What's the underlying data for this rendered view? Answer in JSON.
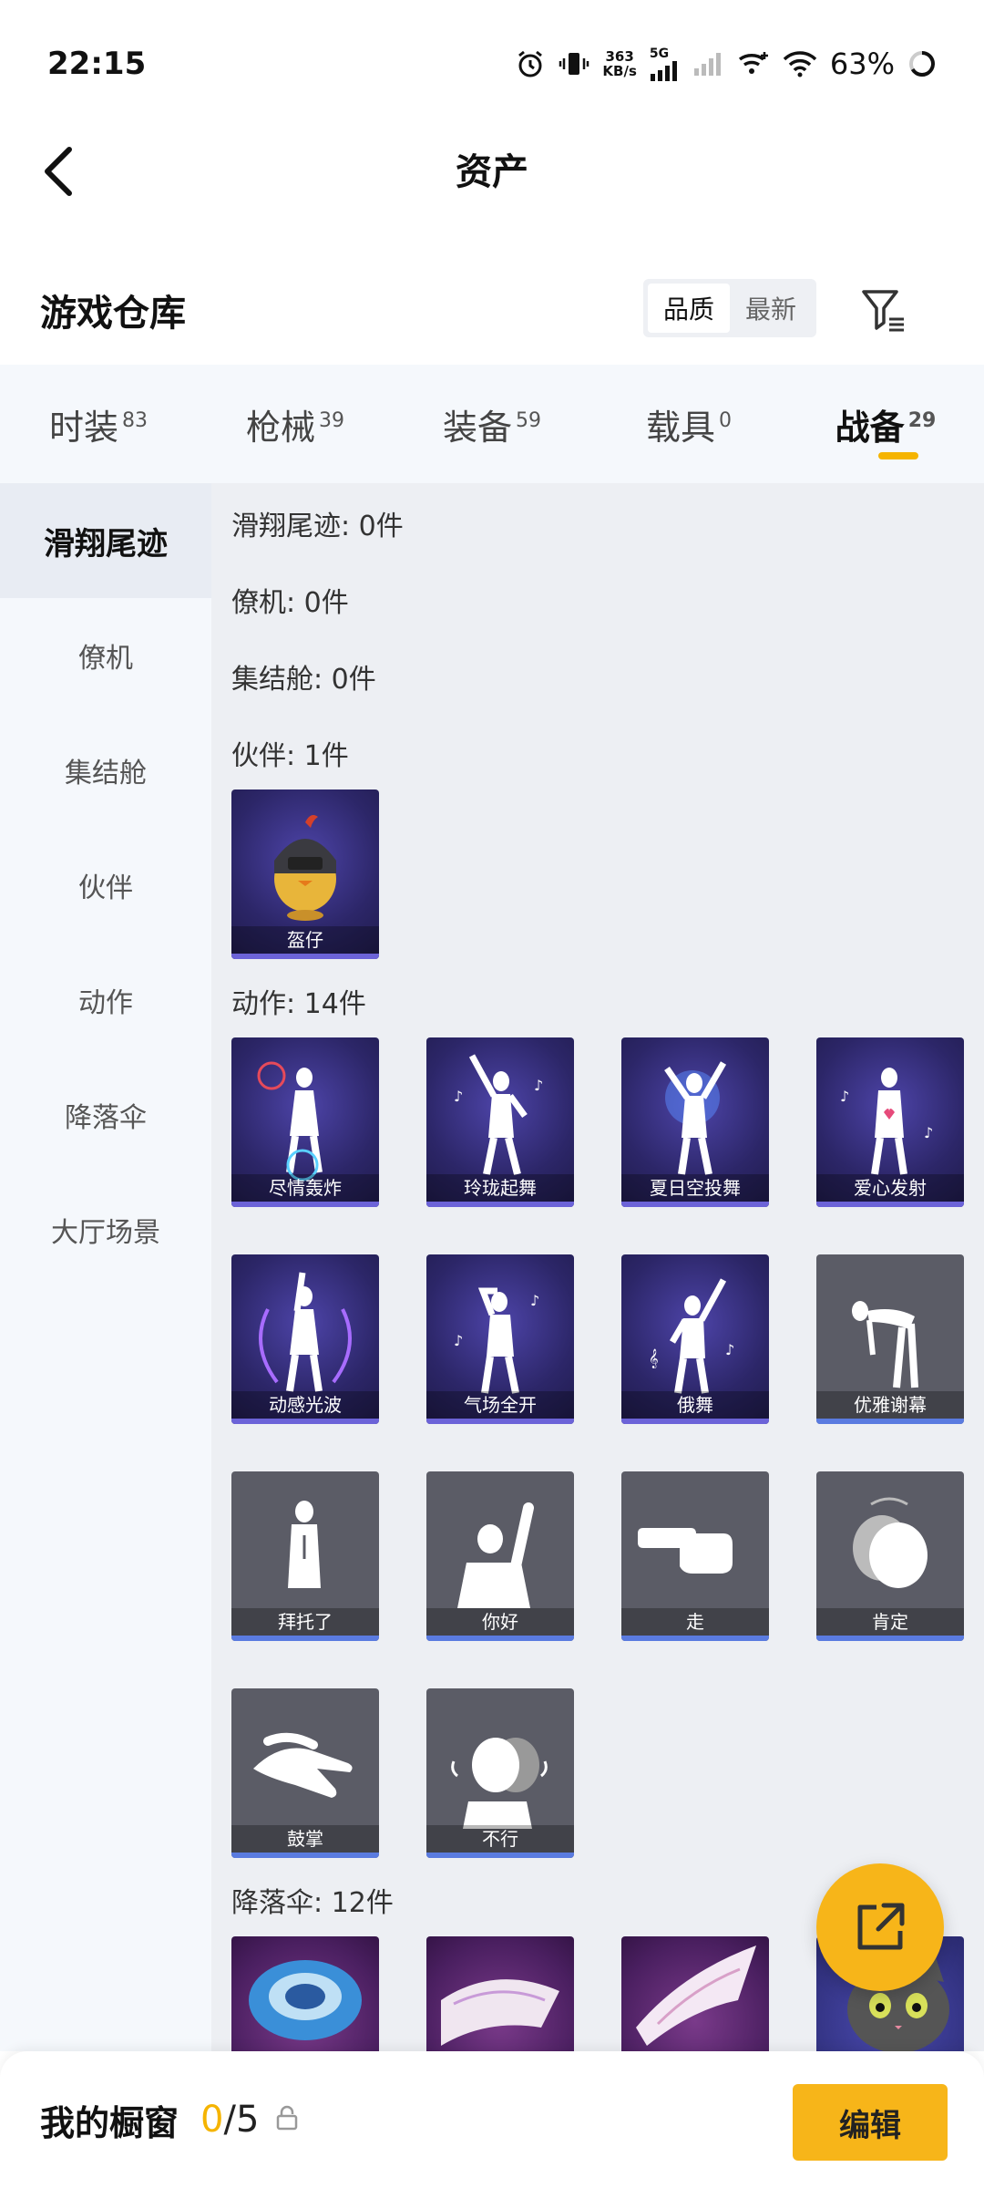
{
  "status_bar": {
    "time": "22:15",
    "net_speed_value": "363",
    "net_speed_unit": "KB/s",
    "network": "5G",
    "battery": "63%"
  },
  "header": {
    "title": "资产"
  },
  "warehouse": {
    "title": "游戏仓库",
    "sort_options": [
      "品质",
      "最新"
    ],
    "active_sort": "品质"
  },
  "tabs": [
    {
      "label": "时装",
      "count": "83"
    },
    {
      "label": "枪械",
      "count": "39"
    },
    {
      "label": "装备",
      "count": "59"
    },
    {
      "label": "载具",
      "count": "0"
    },
    {
      "label": "战备",
      "count": "29",
      "active": true
    }
  ],
  "sidebar": {
    "items": [
      "滑翔尾迹",
      "僚机",
      "集结舱",
      "伙伴",
      "动作",
      "降落伞",
      "大厅场景"
    ],
    "active": "滑翔尾迹"
  },
  "sections": {
    "glide": "滑翔尾迹: 0件",
    "wingman": "僚机: 0件",
    "rally": "集结舱: 0件",
    "partner": "伙伴: 1件",
    "emote": "动作: 14件",
    "parachute": "降落伞: 12件"
  },
  "partner_items": [
    {
      "name": "盔仔"
    }
  ],
  "emote_items": [
    {
      "name": "尽情轰炸"
    },
    {
      "name": "玲珑起舞"
    },
    {
      "name": "夏日空投舞"
    },
    {
      "name": "爱心发射"
    },
    {
      "name": "动感光波"
    },
    {
      "name": "气场全开"
    },
    {
      "name": "俄舞"
    },
    {
      "name": "优雅谢幕"
    },
    {
      "name": "拜托了"
    },
    {
      "name": "你好"
    },
    {
      "name": "走"
    },
    {
      "name": "肯定"
    },
    {
      "name": "鼓掌"
    },
    {
      "name": "不行"
    }
  ],
  "bottom_bar": {
    "label": "我的橱窗",
    "count_current": "0",
    "count_total": "/5",
    "edit": "编辑"
  },
  "colors": {
    "accent": "#f5b400",
    "card_purple": "#2c2668",
    "card_gray": "#5b5c66",
    "card_parachute": "#4a1f60"
  }
}
